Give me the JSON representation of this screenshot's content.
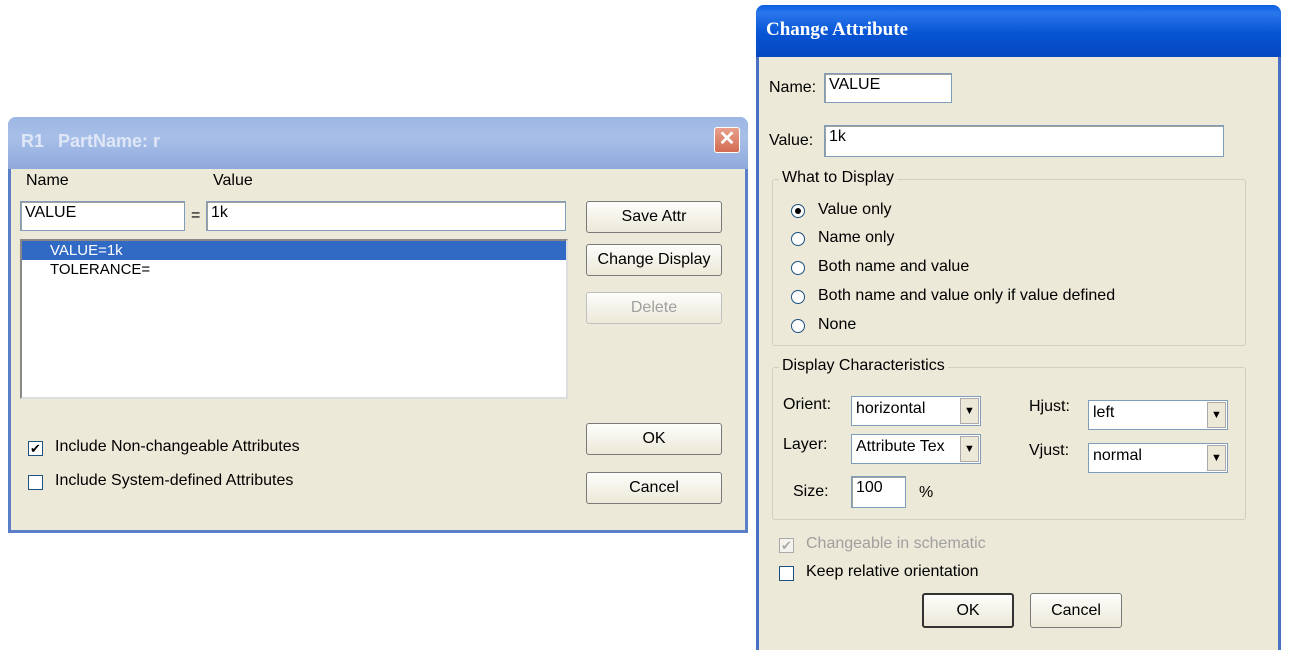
{
  "dialog1": {
    "title_ref": "R1",
    "title_text": "PartName: r",
    "close_glyph": "✕",
    "name_header": "Name",
    "value_header": "Value",
    "name_value": "VALUE",
    "equals": "=",
    "value_value": "1k",
    "attributes": [
      "VALUE=1k",
      "TOLERANCE="
    ],
    "save_attr": "Save Attr",
    "change_display": "Change Display",
    "delete": "Delete",
    "include_nonchangeable": "Include Non-changeable Attributes",
    "include_nonchangeable_checked": true,
    "include_system": "Include System-defined Attributes",
    "include_system_checked": false,
    "ok": "OK",
    "cancel": "Cancel"
  },
  "dialog2": {
    "title": "Change Attribute",
    "name_label": "Name:",
    "name_value": "VALUE",
    "value_label": "Value:",
    "value_value": "1k",
    "what_to_display": "What to Display",
    "display_options": [
      "Value only",
      "Name only",
      "Both name and value",
      "Both name and value only if value defined",
      "None"
    ],
    "display_selected": 0,
    "display_characteristics": "Display Characteristics",
    "orient_label": "Orient:",
    "orient_value": "horizontal",
    "layer_label": "Layer:",
    "layer_value": "Attribute Tex",
    "size_label": "Size:",
    "size_value": "100",
    "size_unit": "%",
    "hjust_label": "Hjust:",
    "hjust_value": "left",
    "vjust_label": "Vjust:",
    "vjust_value": "normal",
    "changeable": "Changeable in schematic",
    "changeable_checked": true,
    "keep_relative": "Keep relative orientation",
    "keep_relative_checked": false,
    "ok": "OK",
    "cancel": "Cancel",
    "dropdown_glyph": "▼"
  }
}
